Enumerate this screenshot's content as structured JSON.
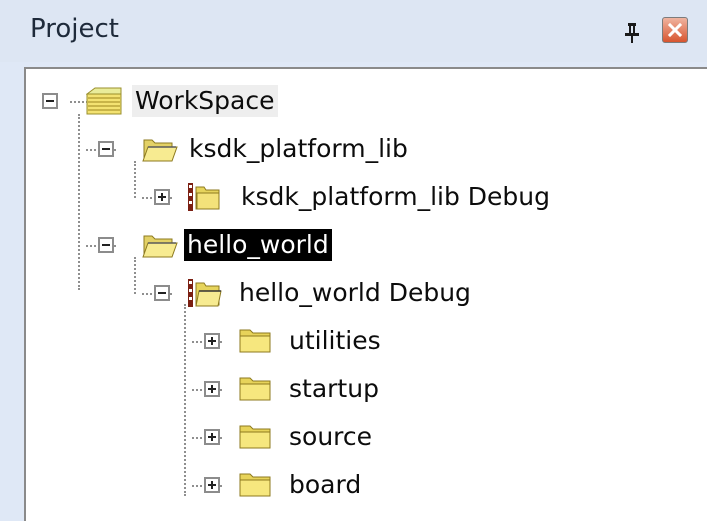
{
  "panel": {
    "title": "Project"
  },
  "tree": {
    "workspace": {
      "label": "WorkSpace"
    },
    "ksdk_platform_lib": {
      "label": "ksdk_platform_lib"
    },
    "ksdk_platform_lib_debug": {
      "label": "ksdk_platform_lib Debug"
    },
    "hello_world": {
      "label": "hello_world"
    },
    "hello_world_debug": {
      "label": "hello_world Debug"
    },
    "utilities": {
      "label": "utilities"
    },
    "startup": {
      "label": "startup"
    },
    "source": {
      "label": "source"
    },
    "board": {
      "label": "board"
    }
  },
  "colors": {
    "panel_bg": "#dfe8f6",
    "tree_bg": "#ffffff",
    "folder_yellow": "#f2d84a",
    "selection": "#000000"
  },
  "icons": {
    "pin": "pin-icon",
    "close": "close-icon",
    "workspace": "workspace-icon",
    "project": "folder-open-icon",
    "target": "target-folder-icon",
    "group": "folder-icon"
  }
}
